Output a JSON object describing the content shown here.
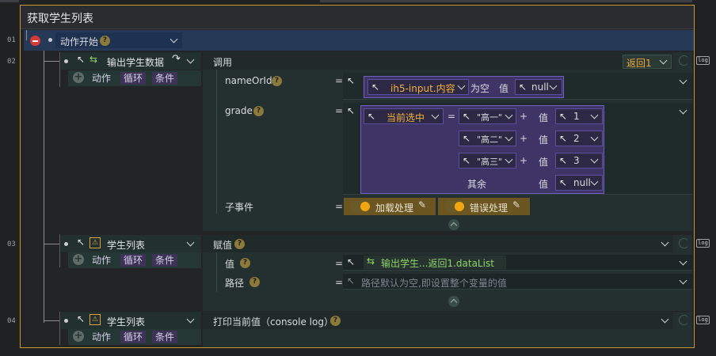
{
  "title": "获取学生列表",
  "line_numbers": [
    "01",
    "02",
    "03",
    "04"
  ],
  "start": {
    "label": "动作开始"
  },
  "sub_tabs": {
    "action": "动作",
    "loop": "循环",
    "condition": "条件"
  },
  "nodes": [
    {
      "title": "输出学生数据"
    },
    {
      "title": "学生列表"
    },
    {
      "title": "学生列表"
    }
  ],
  "call_panel": {
    "title": "调用",
    "return_label": "返回1",
    "fields": {
      "nameOrId": {
        "label": "nameOrId",
        "equals": "=",
        "input_ref": "ih5-input.内容",
        "condition": "为空",
        "value_label": "值",
        "value": "null"
      },
      "grade": {
        "label": "grade",
        "equals": "=",
        "selector": "当前选中",
        "op": "=",
        "plus": "+",
        "value_label": "值",
        "rows": [
          {
            "match": "\"高一\"",
            "value": "1"
          },
          {
            "match": "\"高二\"",
            "value": "2"
          },
          {
            "match": "\"高三\"",
            "value": "3"
          }
        ],
        "else_label": "其余",
        "else_value": "null"
      },
      "sub_events": {
        "label": "子事件",
        "equals": "=",
        "load": "加载处理",
        "error": "错误处理"
      }
    }
  },
  "assign_panel": {
    "title": "赋值",
    "value_label": "值",
    "value_ref": "输出学生...返回1.dataList",
    "path_label": "路径",
    "path_placeholder": "路径默认为空,即设置整个变量的值",
    "equals": "="
  },
  "print_panel": {
    "title": "打印当前值（console log）"
  },
  "log_icon": "log",
  "colors": {
    "accent": "#c8982f",
    "orange": "#f2b13c",
    "purple": "#3e3566",
    "start_bar": "#263a57"
  }
}
